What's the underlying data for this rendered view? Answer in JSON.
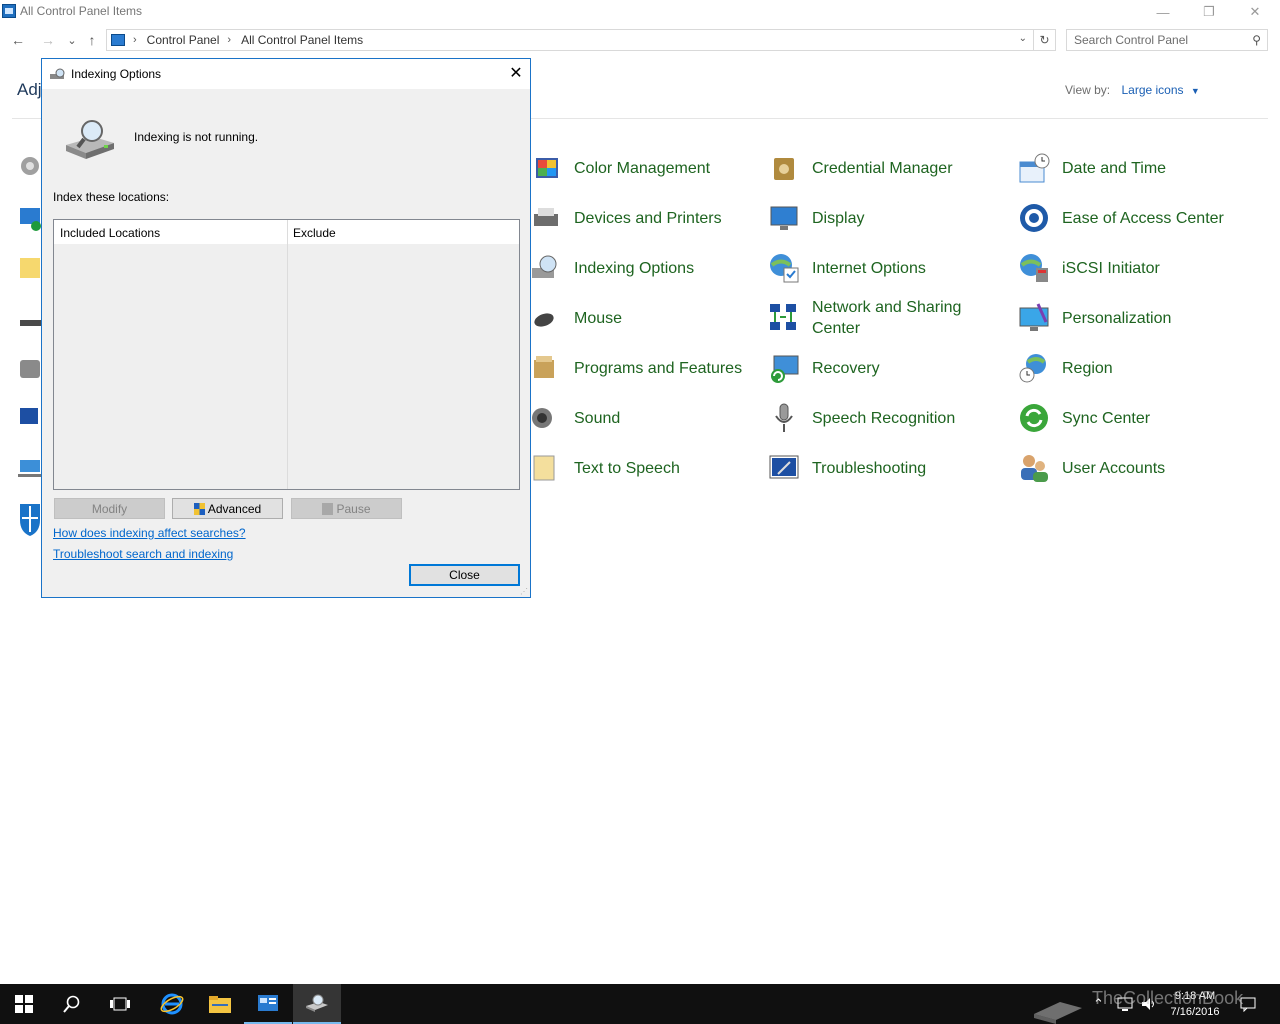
{
  "window": {
    "title": "All Control Panel Items",
    "controls": {
      "minimize": "—",
      "maximize": "❐",
      "close": "✕"
    }
  },
  "nav": {
    "back": "←",
    "forward": "→",
    "recent": "⌄",
    "up": "↑",
    "breadcrumb": [
      "Control Panel",
      "All Control Panel Items"
    ],
    "dropdown": "⌄",
    "refresh": "↻",
    "search_placeholder": "Search Control Panel"
  },
  "header": {
    "title_partial": "Adj"
  },
  "view_by": {
    "label": "View by:",
    "value": "Large icons",
    "arrow": "▼"
  },
  "items": [
    {
      "label": "Color Management",
      "icon": "color-management-icon"
    },
    {
      "label": "Credential Manager",
      "icon": "credential-manager-icon"
    },
    {
      "label": "Date and Time",
      "icon": "date-time-icon"
    },
    {
      "label": "Devices and Printers",
      "icon": "devices-printers-icon"
    },
    {
      "label": "Display",
      "icon": "display-icon"
    },
    {
      "label": "Ease of Access Center",
      "icon": "ease-of-access-icon"
    },
    {
      "label": "Indexing Options",
      "icon": "indexing-options-icon"
    },
    {
      "label": "Internet Options",
      "icon": "internet-options-icon"
    },
    {
      "label": "iSCSI Initiator",
      "icon": "iscsi-initiator-icon"
    },
    {
      "label": "Mouse",
      "icon": "mouse-icon"
    },
    {
      "label": "Network and Sharing Center",
      "icon": "network-sharing-icon"
    },
    {
      "label": "Personalization",
      "icon": "personalization-icon"
    },
    {
      "label": "Programs and Features",
      "icon": "programs-features-icon"
    },
    {
      "label": "Recovery",
      "icon": "recovery-icon"
    },
    {
      "label": "Region",
      "icon": "region-icon"
    },
    {
      "label": "Sound",
      "icon": "sound-icon"
    },
    {
      "label": "Speech Recognition",
      "icon": "speech-recognition-icon"
    },
    {
      "label": "Sync Center",
      "icon": "sync-center-icon"
    },
    {
      "label": "Text to Speech",
      "icon": "text-to-speech-icon"
    },
    {
      "label": "Troubleshooting",
      "icon": "troubleshooting-icon"
    },
    {
      "label": "User Accounts",
      "icon": "user-accounts-icon"
    }
  ],
  "dialog": {
    "title": "Indexing Options",
    "close_glyph": "✕",
    "status": "Indexing is not running.",
    "locations_label": "Index these locations:",
    "columns": [
      "Included Locations",
      "Exclude"
    ],
    "buttons": {
      "modify": "Modify",
      "advanced": "Advanced",
      "pause": "Pause",
      "close": "Close"
    },
    "links": [
      "How does indexing affect searches?",
      "Troubleshoot search and indexing"
    ]
  },
  "taskbar": {
    "time": "9:18 AM",
    "date": "7/16/2016",
    "apps": [
      "start-icon",
      "search-icon",
      "task-view-icon",
      "internet-explorer-icon",
      "file-explorer-icon",
      "control-panel-icon",
      "indexing-options-icon"
    ]
  },
  "watermark": "TheCollectionBook",
  "colors": {
    "link_green": "#1e6420",
    "accent": "#0078d7",
    "taskbar": "#101010"
  }
}
